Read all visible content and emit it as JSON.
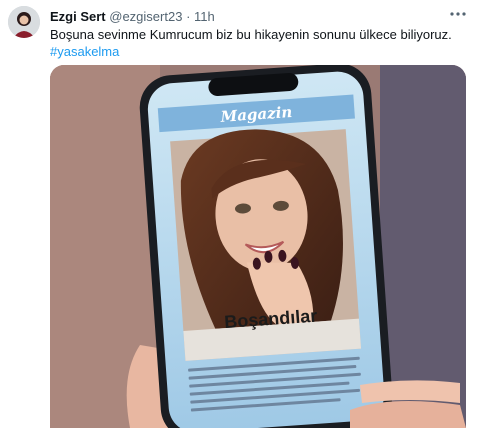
{
  "tweet": {
    "author_name": "Ezgi Sert",
    "handle": "@ezgisert23",
    "separator": "·",
    "time": "11h",
    "more_icon": "more-dots-icon",
    "text": "Boşuna sevinme Kumrucum biz bu hikayenin sonunu ülkece biliyoruz.",
    "hashtag": "#yasakelma"
  },
  "media": {
    "magazine_title": "Magazin",
    "headline": "Boşandılar"
  },
  "colors": {
    "link": "#1d9bf0",
    "secondary_text": "#536471"
  }
}
